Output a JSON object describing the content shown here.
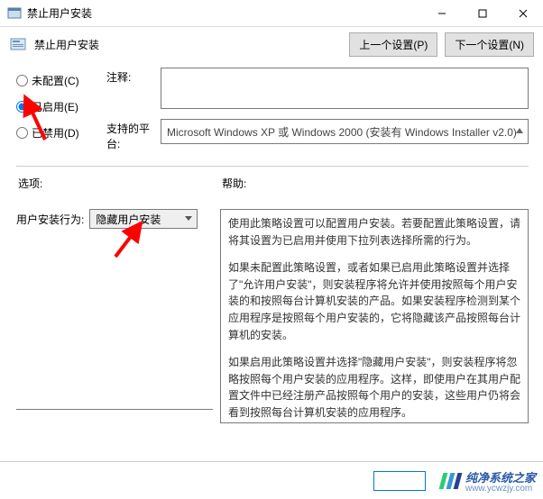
{
  "window": {
    "title": "禁止用户安装",
    "min_icon": "minimize-icon",
    "max_icon": "maximize-icon",
    "close_icon": "close-icon"
  },
  "header": {
    "title": "禁止用户安装",
    "prev_btn": "上一个设置(P)",
    "next_btn": "下一个设置(N)"
  },
  "radios": {
    "not_configured": "未配置(C)",
    "enabled": "已启用(E)",
    "disabled": "已禁用(D)",
    "selected": "enabled"
  },
  "comment": {
    "label": "注释:",
    "value": ""
  },
  "platform": {
    "label": "支持的平台:",
    "value": "Microsoft Windows XP 或 Windows 2000 (安装有 Windows Installer v2.0)"
  },
  "sections": {
    "options_header": "选项:",
    "help_header": "帮助:"
  },
  "option": {
    "label": "用户安装行为:",
    "value": "隐藏用户安装"
  },
  "help": {
    "p1": "使用此策略设置可以配置用户安装。若要配置此策略设置，请将其设置为已启用并使用下拉列表选择所需的行为。",
    "p2": "如果未配置此策略设置，或者如果已启用此策略设置并选择了\"允许用户安装\"，则安装程序将允许并使用按照每个用户安装的和按照每台计算机安装的产品。如果安装程序检测到某个应用程序是按照每个用户安装的，它将隐藏该产品按照每台计算机的安装。",
    "p3": "如果启用此策略设置并选择\"隐藏用户安装\"，则安装程序将忽略按照每个用户安装的应用程序。这样，即使用户在其用户配置文件中已经注册产品按照每个用户的安装，这些用户仍将会看到按照每台计算机安装的应用程序。"
  },
  "watermark": {
    "brand": "纯净系统之家",
    "url": "www.ycwzjy.com"
  }
}
